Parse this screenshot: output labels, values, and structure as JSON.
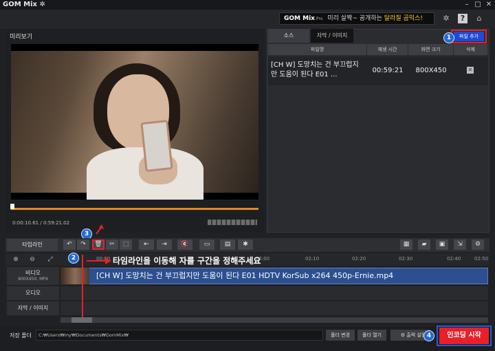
{
  "app": {
    "title": "GOM Mix",
    "title_icon": "gear-icon"
  },
  "banner": {
    "brand": "GOM Mix",
    "brand_suffix": "Pro",
    "text_plain": "미리 살짝~ 공개하는",
    "text_highlight": "달라질 곰믹스!"
  },
  "preview": {
    "label": "미리보기",
    "time_current": "0:00:10.61",
    "time_total": "0:59:21.02",
    "progress": 0.003
  },
  "source_panel": {
    "tabs": [
      {
        "label": "소스"
      },
      {
        "label": "자막 / 이미지"
      }
    ],
    "add_file_label": "파일 추가",
    "columns": [
      "파일명",
      "재생 시간",
      "화면 크기",
      "삭제"
    ],
    "rows": [
      {
        "name": "[CH W] 도망치는 건 부끄럽지만 도움이 된다 E01 ...",
        "duration": "00:59:21",
        "size": "800X450",
        "delete": "✕"
      }
    ]
  },
  "annotations": [
    {
      "number": "1"
    },
    {
      "number": "2",
      "text": "타임라인을 이동해 자를 구간을 정해주세요"
    },
    {
      "number": "3",
      "text": "자르기 이모티콘"
    },
    {
      "number": "4"
    }
  ],
  "timeline": {
    "tab_label": "타임라인",
    "ruler_ticks": [
      "00:00",
      "02:00",
      "02:10",
      "02:20",
      "02:30",
      "02:40",
      "02:50"
    ],
    "tracks": [
      {
        "label": "비디오",
        "sub": "800X450, MP4"
      },
      {
        "label": "오디오",
        "sub": ""
      },
      {
        "label": "자막 / 이미지",
        "sub": ""
      }
    ],
    "clip_name": "[CH W] 도망치는 건 부끄럽지만 도움이 된다 E01 HDTV KorSub x264 450p-Ernie.mp4"
  },
  "bottom": {
    "save_folder_label": "저장 폴더",
    "save_path": "C:₩Users₩my₩Documents₩GomMix₩",
    "change_folder": "폴더 변경",
    "open_folder": "폴더 열기",
    "output_settings": "출력 설정",
    "start_encoding": "인코딩 시작"
  },
  "colors": {
    "accent_orange": "#e58a1e",
    "annotation_red": "#e8202a",
    "badge_blue": "#2369d8",
    "encode_red": "#e8202a"
  }
}
